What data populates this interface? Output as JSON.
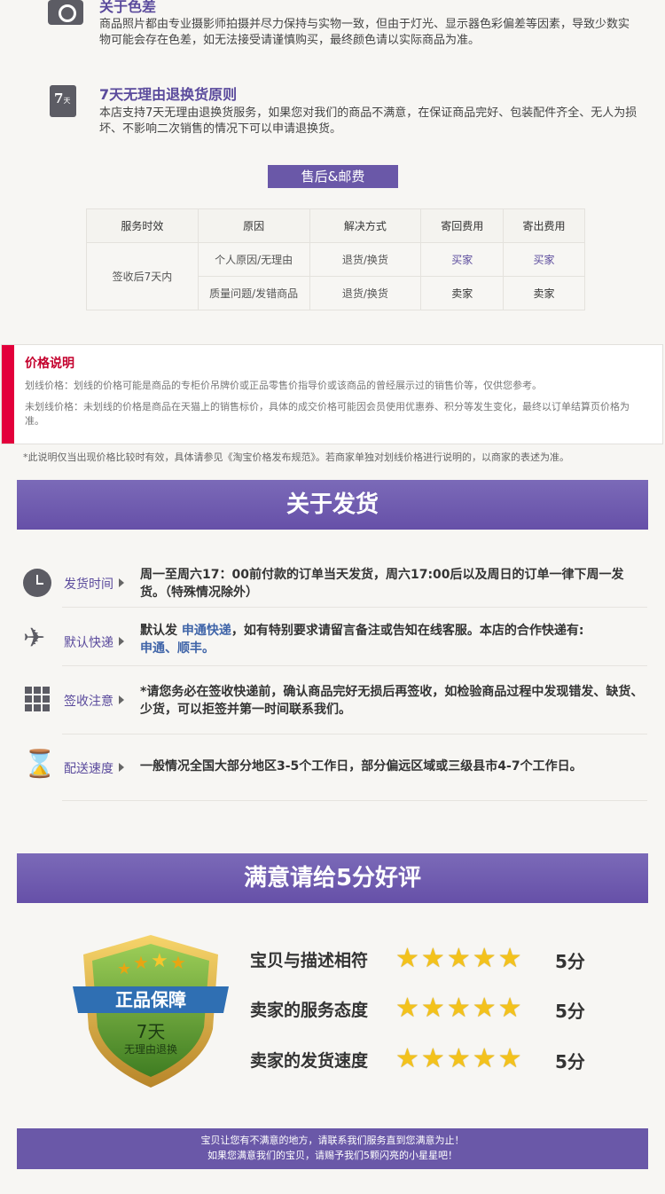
{
  "color_info": {
    "title": "关于色差",
    "text": "商品照片都由专业摄影师拍摄并尽力保持与实物一致，但由于灯光、显示器色彩偏差等因素，导致少数实物可能会存在色差，如无法接受请谨慎购买，最终颜色请以实际商品为准。"
  },
  "return_policy": {
    "icon_text": "7",
    "icon_sub": "天",
    "title": "7天无理由退换货原则",
    "text": "本店支持7天无理由退换货服务，如果您对我们的商品不满意，在保证商品完好、包装配件齐全、无人为损坏、不影响二次销售的情况下可以申请退换货。"
  },
  "after_sale": {
    "header": "售后&邮费",
    "columns": [
      "服务时效",
      "原因",
      "解决方式",
      "寄回费用",
      "寄出费用"
    ],
    "time": "签收后7天内",
    "rows": [
      {
        "reason": "个人原因/无理由",
        "solution": "退货/换货",
        "return_fee": "买家",
        "send_fee": "买家"
      },
      {
        "reason": "质量问题/发错商品",
        "solution": "退货/换货",
        "return_fee": "卖家",
        "send_fee": "卖家"
      }
    ]
  },
  "price_notice": {
    "title": "价格说明",
    "line1": "划线价格：划线的价格可能是商品的专柜价吊牌价或正品零售价指导价或该商品的曾经展示过的销售价等，仅供您参考。",
    "line2": "未划线价格：未划线的价格是商品在天猫上的销售标价，具体的成交价格可能因会员使用优惠券、积分等发生变化，最终以订单结算页价格为准。",
    "footnote": "*此说明仅当出现价格比较时有效，具体请参见《淘宝价格发布规范》。若商家单独对划线价格进行说明的，以商家的表述为准。"
  },
  "shipping": {
    "header": "关于发货",
    "rows": [
      {
        "icon": "clock-icon",
        "label": "发货时间",
        "text": "周一至周六17：00前付款的订单当天发货，周六17:00后以及周日的订单一律下周一发货。（特殊情况除外）"
      },
      {
        "icon": "airplane-icon",
        "label": "默认快递",
        "text_pre": "默认发 ",
        "text_hl": "申通快递",
        "text_mid": "，如有特别要求请留言备注或告知在线客服。本店的合作快递有:",
        "text_hl2": "申通、顺丰。"
      },
      {
        "icon": "grid-icon",
        "label": "签收注意",
        "text": "*请您务必在签收快递前，确认商品完好无损后再签收，如检验商品过程中发现错发、缺货、少货，可以拒签并第一时间联系我们。"
      },
      {
        "icon": "hourglass-icon",
        "label": "配送速度",
        "text": "一般情况全国大部分地区3-5个工作日，部分偏远区域或三级县市4-7个工作日。"
      }
    ]
  },
  "rating": {
    "header": "满意请给5分好评",
    "badge_title": "正品保障",
    "badge_days": "7天",
    "badge_sub": "无理由退换",
    "items": [
      {
        "label": "宝贝与描述相符",
        "stars": 5,
        "score": "5分"
      },
      {
        "label": "卖家的服务态度",
        "stars": 5,
        "score": "5分"
      },
      {
        "label": "卖家的发货速度",
        "stars": 5,
        "score": "5分"
      }
    ]
  },
  "footer": {
    "line1": "宝贝让您有不满意的地方，请联系我们服务直到您满意为止！",
    "line2": "如果您满意我们的宝贝，请赐予我们5颗闪亮的小星星吧！"
  },
  "colors": {
    "purple": "#6a58a8",
    "red": "#e3003b",
    "star": "#f3c21c"
  }
}
